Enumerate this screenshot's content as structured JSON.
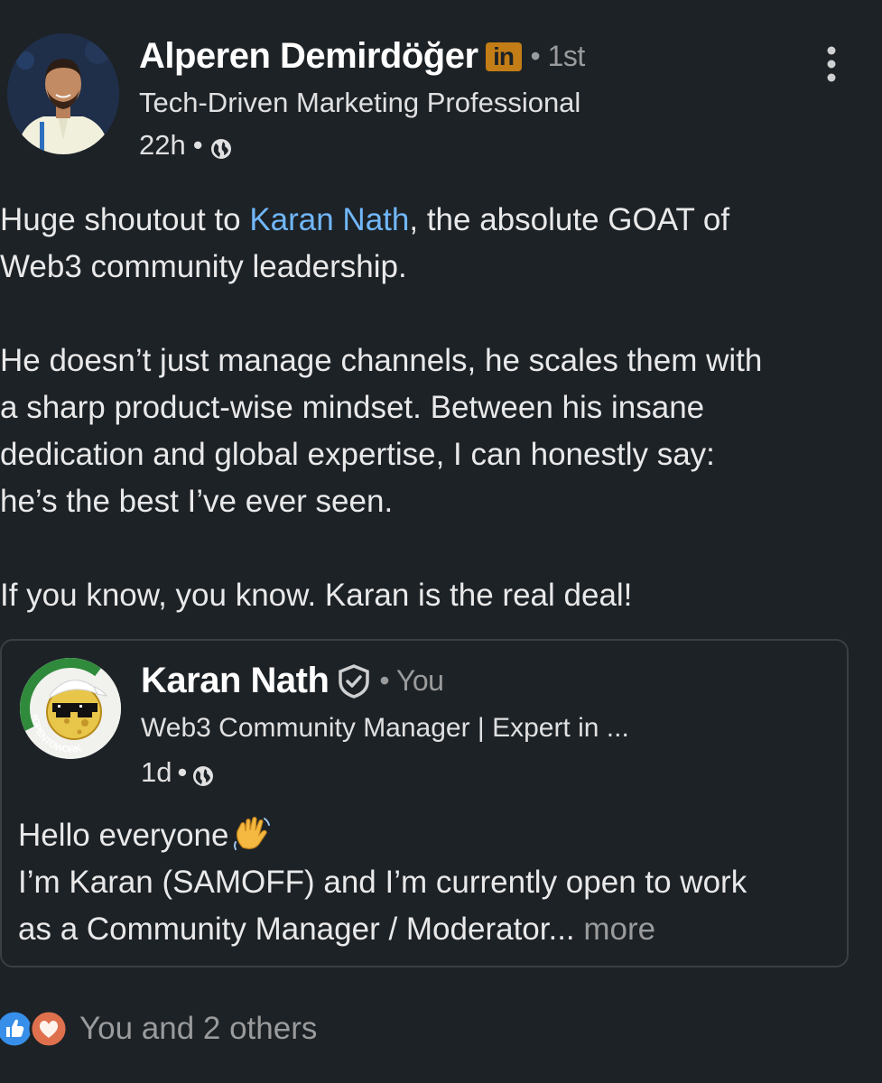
{
  "post": {
    "author": {
      "name": "Alperen Demirdöğer",
      "badge": "in",
      "degree": "• 1st",
      "headline": "Tech-Driven Marketing Professional",
      "time": "22h",
      "dot": "•",
      "visibility_icon": "globe-icon"
    },
    "body": {
      "line1_prefix": "Huge shoutout to ",
      "mention": "Karan Nath",
      "line1_suffix": ", the absolute GOAT of",
      "line2": "Web3 community leadership.",
      "line3": "He doesn’t just manage channels, he scales them with",
      "line4": "a sharp product-wise mindset. Between his insane",
      "line5": "dedication and global expertise, I can honestly say:",
      "line6": "he’s the best I’ve ever seen.",
      "line7": "If you know, you know. Karan is the real deal!"
    },
    "shared_post": {
      "author_name": "Karan Nath",
      "verified_icon": "verified-shield-icon",
      "relation": "• You",
      "headline": "Web3 Community Manager | Expert in ...",
      "time": "1d",
      "dot": "•",
      "avatar_frame_text": "#OPENTOWORK",
      "text_line1": "Hello everyone",
      "text_line2": "I’m Karan (SAMOFF) and I’m currently open to work",
      "text_line3": "as a Community Manager / Moderator...",
      "more_label": " more"
    },
    "reactions": {
      "icons": [
        "like-icon",
        "love-icon"
      ],
      "summary": "You and 2 others"
    }
  },
  "colors": {
    "background": "#1d2226",
    "link": "#71b7fb",
    "muted": "#9a9b9c",
    "linkedin_badge": "#c37d16",
    "opentowork_green": "#2f8a3b"
  }
}
